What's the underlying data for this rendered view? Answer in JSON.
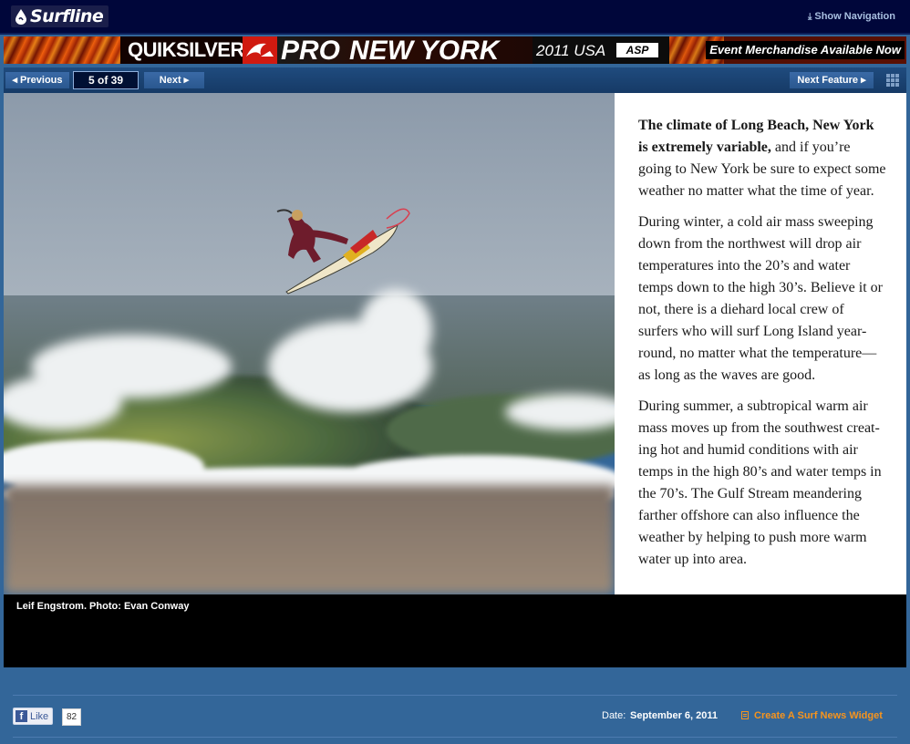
{
  "header": {
    "logo_text": "Surfline",
    "show_navigation": "Show Navigation"
  },
  "banner": {
    "brand": "QUIKSILVER",
    "pro": "PRO",
    "event": "NEW YORK",
    "year_location": "2011 USA",
    "partner_logo": "ASP",
    "merch": "Event Merchandise Available Now"
  },
  "slideshow": {
    "prev_label": "Previous",
    "counter": "5 of 39",
    "next_label": "Next",
    "next_feature_label": "Next Feature"
  },
  "photo": {
    "caption": "Leif Engstrom. Photo: Evan Conway"
  },
  "article": {
    "p1_lead": "The climate of Long Beach, New York is extremely variable,",
    "p1_rest": " and if you’re going to New York be sure to expect some weather no matter what the time of year.",
    "p2": "During winter, a cold air mass sweeping down from the northwest will drop air temperatures into the 20’s and water temps down to the high 30’s. Believe it or not, there is a diehard local crew of surfers who will surf Long Island year-round, no matter what the temperature—as long as the waves are good.",
    "p3": "During summer, a subtropical warm air mass moves up from the southwest creat-ing hot and humid conditions with air temps in the high 80’s and water temps in the 70’s. The Gulf Stream meandering farther offshore can also influence the weather by helping to push more warm water up into area."
  },
  "footer": {
    "like_label": "Like",
    "like_count": "82",
    "date_label": "Date:",
    "date_value": "September 6, 2011",
    "widget_link": "Create A Surf News Widget"
  },
  "colors": {
    "page_bg": "#336699",
    "topbar_bg": "#00063a",
    "widget_link": "#f7941d"
  }
}
